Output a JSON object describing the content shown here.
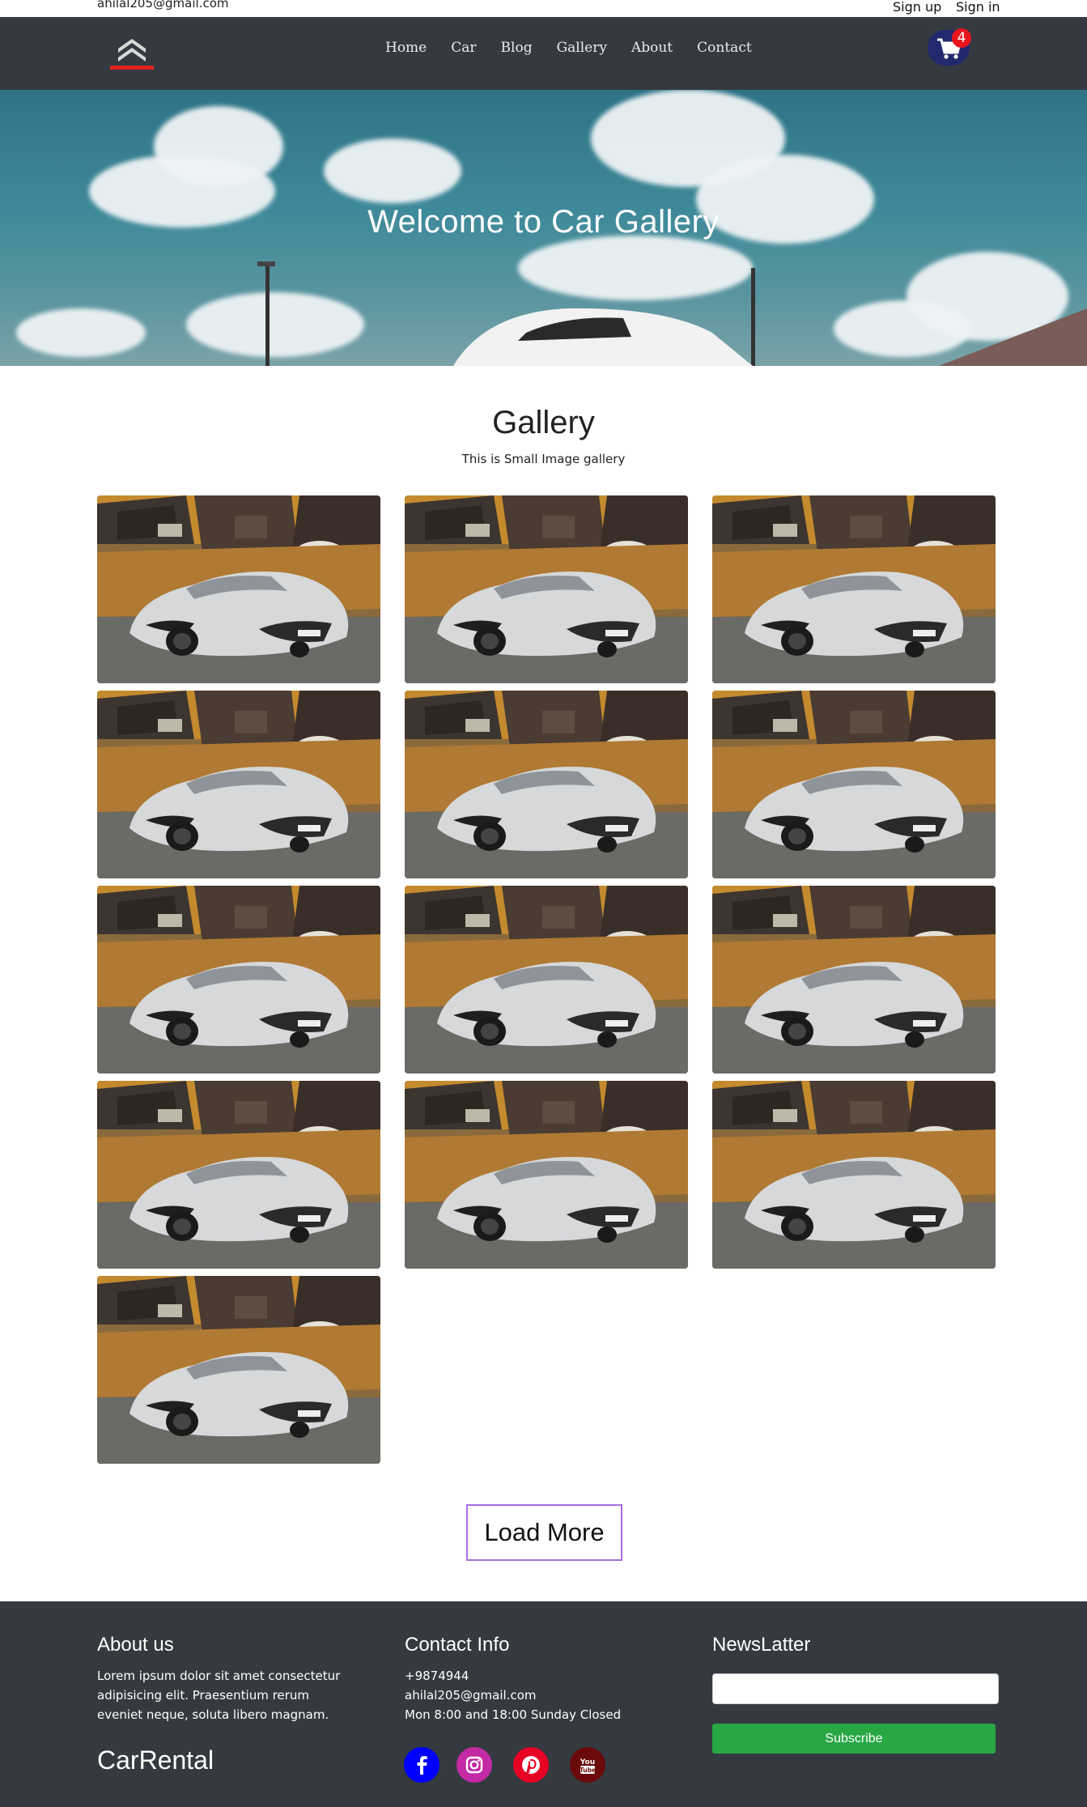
{
  "topbar": {
    "email": "ahilal205@gmail.com",
    "signup": "Sign up",
    "signin": "Sign in"
  },
  "nav": {
    "logo_text": "CITROËN",
    "links": [
      "Home",
      "Car",
      "Blog",
      "Gallery",
      "About",
      "Contact"
    ],
    "cart_count": "4"
  },
  "hero": {
    "title": "Welcome to Car Gallery"
  },
  "gallery": {
    "title": "Gallery",
    "subtitle": "This is Small Image gallery",
    "image_count": 13,
    "load_more": "Load More"
  },
  "footer": {
    "about_title": "About us",
    "about_text": "Lorem ipsum dolor sit amet consectetur adipisicing elit. Praesentium rerum eveniet neque, soluta libero magnam.",
    "brand": "CarRental",
    "contact_title": "Contact Info",
    "phone": "+9874944",
    "email": "ahilal205@gmail.com",
    "hours": "Mon 8:00 and 18:00 Sunday Closed",
    "newsletter_title": "NewsLatter",
    "subscribe": "Subscribe",
    "social": [
      {
        "name": "facebook-icon",
        "color": "#0000ff"
      },
      {
        "name": "instagram-icon",
        "color": "#c32aa3"
      },
      {
        "name": "pinterest-icon",
        "color": "#e60023"
      },
      {
        "name": "youtube-icon",
        "color": "#6b0a0a"
      }
    ]
  },
  "colors": {
    "navbar": "#343a40",
    "footer": "#343a40",
    "subscribe": "#28a745",
    "load_more_border": "#a66ee0"
  }
}
